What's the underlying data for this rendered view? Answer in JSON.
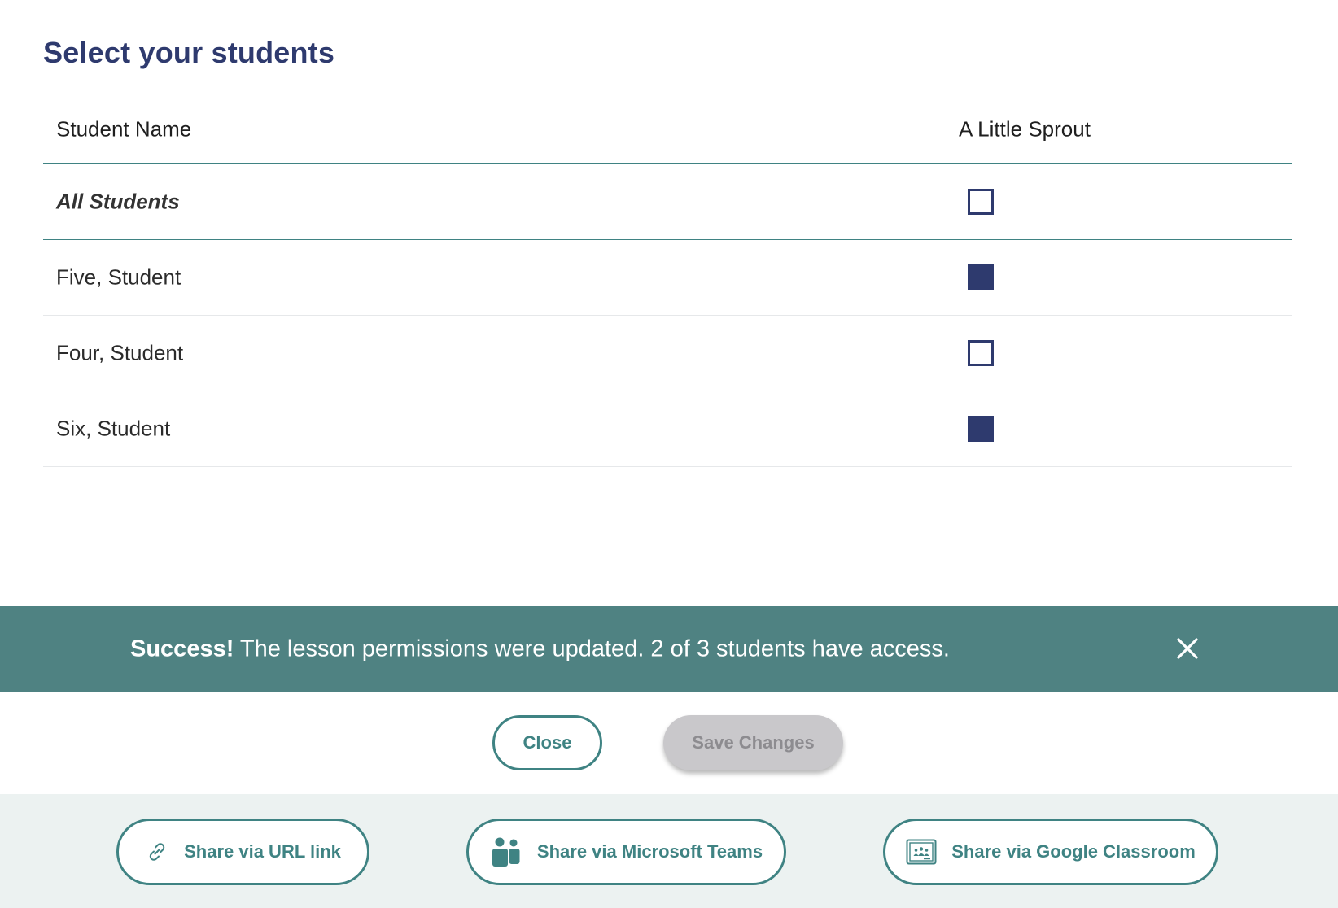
{
  "page": {
    "title": "Select your students"
  },
  "table": {
    "headers": {
      "name": "Student Name",
      "lesson": "A Little Sprout"
    },
    "all_row": {
      "label": "All Students",
      "checked": false
    },
    "rows": [
      {
        "name": "Five, Student",
        "checked": true
      },
      {
        "name": "Four, Student",
        "checked": false
      },
      {
        "name": "Six, Student",
        "checked": true
      }
    ]
  },
  "banner": {
    "strong": "Success!",
    "message": " The lesson permissions were updated. 2 of 3 students have access.",
    "close_icon": "close-icon"
  },
  "actions": {
    "close_label": "Close",
    "save_label": "Save Changes"
  },
  "share": {
    "url_label": "Share via URL link",
    "url_icon": "link-icon",
    "teams_label": "Share via Microsoft Teams",
    "teams_icon": "microsoft-teams-icon",
    "gc_label": "Share via Google Classroom",
    "gc_icon": "google-classroom-icon"
  },
  "colors": {
    "title": "#2e3a6e",
    "accent_teal": "#3f8383",
    "banner_bg": "#4f8282",
    "checkbox": "#2e3a6e",
    "share_bar_bg": "#ecf2f1",
    "save_disabled_bg": "#c9c8cb"
  }
}
